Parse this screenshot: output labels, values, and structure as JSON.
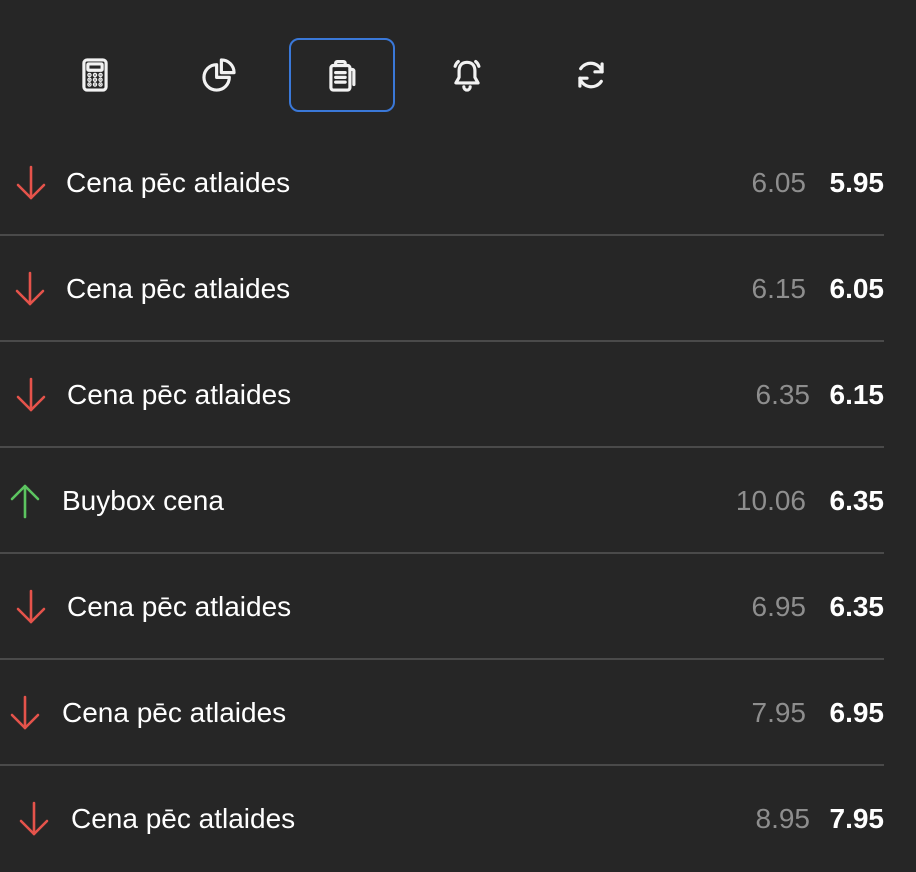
{
  "toolbar": {
    "buttons": [
      {
        "icon": "calculator-icon",
        "active": false
      },
      {
        "icon": "pie-chart-icon",
        "active": false
      },
      {
        "icon": "clipboard-list-icon",
        "active": true
      },
      {
        "icon": "bell-icon",
        "active": false
      },
      {
        "icon": "refresh-icon",
        "active": false
      }
    ]
  },
  "history": {
    "rows": [
      {
        "direction": "down",
        "label": "Cena pēc atlaides",
        "old_price": "6.05",
        "new_price": "5.95"
      },
      {
        "direction": "down",
        "label": "Cena pēc atlaides",
        "old_price": "6.15",
        "new_price": "6.05"
      },
      {
        "direction": "down",
        "label": "Cena pēc atlaides",
        "old_price": "6.35",
        "new_price": "6.15"
      },
      {
        "direction": "up",
        "label": "Buybox cena",
        "old_price": "10.06",
        "new_price": "6.35"
      },
      {
        "direction": "down",
        "label": "Cena pēc atlaides",
        "old_price": "6.95",
        "new_price": "6.35"
      },
      {
        "direction": "down",
        "label": "Cena pēc atlaides",
        "old_price": "7.95",
        "new_price": "6.95"
      },
      {
        "direction": "down",
        "label": "Cena pēc atlaides",
        "old_price": "8.95",
        "new_price": "7.95"
      }
    ]
  },
  "colors": {
    "background": "#262626",
    "down_arrow": "#e5534b",
    "up_arrow": "#5cc460",
    "active_border": "#3a78d8",
    "old_price": "#8e8e8e",
    "divider": "#4a4a4a"
  }
}
